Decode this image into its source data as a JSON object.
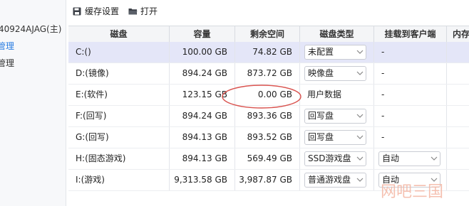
{
  "sidebar": {
    "items": [
      {
        "label": "40924AJAG(主)"
      },
      {
        "label": "管理"
      },
      {
        "label": "管理"
      }
    ]
  },
  "toolbar": {
    "cache_settings_label": "缓存设置",
    "cache_settings_icon": "floppy-disk-icon",
    "open_label": "打开",
    "open_icon": "folder-icon"
  },
  "table": {
    "columns": [
      "磁盘",
      "容量",
      "剩余空间",
      "磁盘类型",
      "挂载到客户端",
      "内存"
    ],
    "rows": [
      {
        "disk": "C:()",
        "capacity": "100.00 GB",
        "free": "74.82 GB",
        "type": "未配置",
        "type_dropdown": true,
        "mount": "-",
        "mount_dropdown": false,
        "selected": true
      },
      {
        "disk": "D:(镜像)",
        "capacity": "894.24 GB",
        "free": "873.72 GB",
        "type": "映像盘",
        "type_dropdown": true,
        "mount": "-",
        "mount_dropdown": false,
        "selected": false
      },
      {
        "disk": "E:(软件)",
        "capacity": "123.15 GB",
        "free": "0.00 GB",
        "type": "用户数据",
        "type_dropdown": false,
        "mount": "-",
        "mount_dropdown": false,
        "selected": false
      },
      {
        "disk": "F:(回写)",
        "capacity": "894.24 GB",
        "free": "893.36 GB",
        "type": "回写盘",
        "type_dropdown": true,
        "mount": "-",
        "mount_dropdown": false,
        "selected": false
      },
      {
        "disk": "G:(回写)",
        "capacity": "894.13 GB",
        "free": "893.52 GB",
        "type": "回写盘",
        "type_dropdown": true,
        "mount": "-",
        "mount_dropdown": false,
        "selected": false
      },
      {
        "disk": "H:(固态游戏)",
        "capacity": "894.13 GB",
        "free": "569.49 GB",
        "type": "SSD游戏盘",
        "type_dropdown": true,
        "mount": "自动",
        "mount_dropdown": true,
        "selected": false
      },
      {
        "disk": "I:(游戏)",
        "capacity": "9,313.58 GB",
        "free": "3,987.87 GB",
        "type": "普通游戏盘",
        "type_dropdown": true,
        "mount": "自动",
        "mount_dropdown": true,
        "selected": false
      }
    ]
  },
  "annotation": {
    "shape": "red-ellipse",
    "color": "#d9534f"
  },
  "watermark": {
    "text": "网吧三国",
    "color": "#f4b6a3"
  },
  "colors": {
    "accent": "#2a7de1",
    "selected_row": "#e4e6f8",
    "header_bg": "#f4f5f7"
  }
}
